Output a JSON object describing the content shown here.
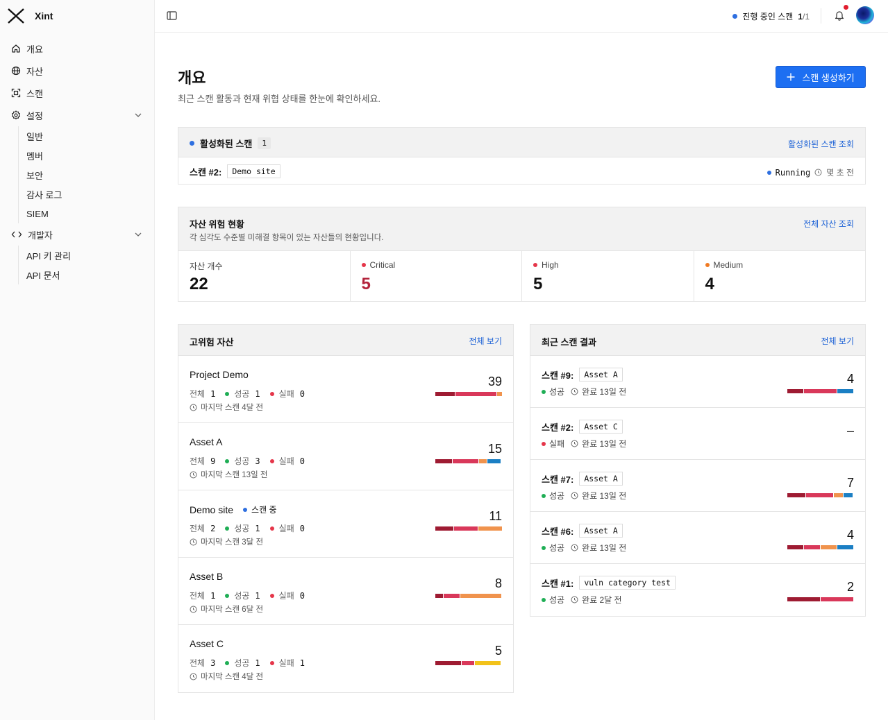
{
  "app": {
    "name": "Xint"
  },
  "colors": {
    "critical": "#9e1b32",
    "high": "#d9385a",
    "medium": "#f0934d",
    "low": "#f2c21a",
    "info": "#1b7fc4",
    "accent": "#1d6ff2"
  },
  "sidebar": {
    "items": [
      {
        "label": "개요",
        "icon": "home-icon"
      },
      {
        "label": "자산",
        "icon": "globe-icon"
      },
      {
        "label": "스캔",
        "icon": "scan-icon"
      },
      {
        "label": "설정",
        "icon": "gear-icon"
      },
      {
        "label": "개발자",
        "icon": "code-icon"
      }
    ],
    "settings_sub": [
      "일반",
      "멤버",
      "보안",
      "감사 로그",
      "SIEM"
    ],
    "developer_sub": [
      "API 키 관리",
      "API 문서"
    ]
  },
  "topbar": {
    "scan_status_label": "진행 중인 스캔",
    "scan_status_count": "1",
    "scan_status_total": "/1"
  },
  "page": {
    "title": "개요",
    "subtitle": "최근 스캔 활동과 현재 위협 상태를 한눈에 확인하세요.",
    "create_button": "스캔 생성하기"
  },
  "active_scans": {
    "title": "활성화된 스캔",
    "count": "1",
    "link": "활성화된 스캔 조회",
    "scan": {
      "label": "스캔 #2:",
      "asset": "Demo site",
      "status": "Running",
      "time": "몇 초 전"
    }
  },
  "asset_risk": {
    "title": "자산 위험 현황",
    "subtitle": "각 심각도 수준별 미해결 항목이 있는 자산들의 현황입니다.",
    "link": "전체 자산 조회",
    "stats": [
      {
        "label": "자산 개수",
        "value": "22"
      },
      {
        "label": "Critical",
        "value": "5"
      },
      {
        "label": "High",
        "value": "5"
      },
      {
        "label": "Medium",
        "value": "4"
      }
    ]
  },
  "high_risk_assets": {
    "title": "고위험 자산",
    "link": "전체 보기",
    "labels": {
      "total": "전체",
      "success": "성공",
      "fail": "실패",
      "scanning": "스캔 중"
    },
    "items": [
      {
        "name": "Project Demo",
        "total": "1",
        "success": "1",
        "fail": "0",
        "last_scan": "마지막 스캔 4달 전",
        "score": "39",
        "scanning": false,
        "segments": [
          {
            "sev": "critical",
            "frac": 0.3
          },
          {
            "sev": "high",
            "frac": 0.62
          },
          {
            "sev": "medium",
            "frac": 0.08
          }
        ]
      },
      {
        "name": "Asset A",
        "total": "9",
        "success": "3",
        "fail": "0",
        "last_scan": "마지막 스캔 13일 전",
        "score": "15",
        "scanning": false,
        "segments": [
          {
            "sev": "critical",
            "frac": 0.26
          },
          {
            "sev": "high",
            "frac": 0.4
          },
          {
            "sev": "medium",
            "frac": 0.13
          },
          {
            "sev": "info",
            "frac": 0.21
          }
        ]
      },
      {
        "name": "Demo site",
        "total": "2",
        "success": "1",
        "fail": "0",
        "last_scan": "마지막 스캔 3달 전",
        "score": "11",
        "scanning": true,
        "segments": [
          {
            "sev": "critical",
            "frac": 0.28
          },
          {
            "sev": "high",
            "frac": 0.36
          },
          {
            "sev": "medium",
            "frac": 0.36
          }
        ]
      },
      {
        "name": "Asset B",
        "total": "1",
        "success": "1",
        "fail": "0",
        "last_scan": "마지막 스캔 6달 전",
        "score": "8",
        "scanning": false,
        "segments": [
          {
            "sev": "critical",
            "frac": 0.12
          },
          {
            "sev": "high",
            "frac": 0.25
          },
          {
            "sev": "medium",
            "frac": 0.63
          }
        ]
      },
      {
        "name": "Asset C",
        "total": "3",
        "success": "1",
        "fail": "1",
        "last_scan": "마지막 스캔 4달 전",
        "score": "5",
        "scanning": false,
        "segments": [
          {
            "sev": "critical",
            "frac": 0.4
          },
          {
            "sev": "high",
            "frac": 0.2
          },
          {
            "sev": "low",
            "frac": 0.4
          }
        ]
      }
    ]
  },
  "recent_scans": {
    "title": "최근 스캔 결과",
    "link": "전체 보기",
    "items": [
      {
        "label": "스캔 #9:",
        "asset": "Asset A",
        "result": "성공",
        "status": "완료 13일 전",
        "score": "4",
        "ok": true,
        "segments": [
          {
            "sev": "critical",
            "frac": 0.25
          },
          {
            "sev": "high",
            "frac": 0.5
          },
          {
            "sev": "info",
            "frac": 0.25
          }
        ]
      },
      {
        "label": "스캔 #2:",
        "asset": "Asset C",
        "result": "실패",
        "status": "완료 13일 전",
        "score": "–",
        "ok": false,
        "segments": []
      },
      {
        "label": "스캔 #7:",
        "asset": "Asset A",
        "result": "성공",
        "status": "완료 13일 전",
        "score": "7",
        "ok": true,
        "segments": [
          {
            "sev": "critical",
            "frac": 0.28
          },
          {
            "sev": "high",
            "frac": 0.42
          },
          {
            "sev": "medium",
            "frac": 0.15
          },
          {
            "sev": "info",
            "frac": 0.15
          }
        ]
      },
      {
        "label": "스캔 #6:",
        "asset": "Asset A",
        "result": "성공",
        "status": "완료 13일 전",
        "score": "4",
        "ok": true,
        "segments": [
          {
            "sev": "critical",
            "frac": 0.25
          },
          {
            "sev": "high",
            "frac": 0.25
          },
          {
            "sev": "medium",
            "frac": 0.25
          },
          {
            "sev": "info",
            "frac": 0.25
          }
        ]
      },
      {
        "label": "스캔 #1:",
        "asset": "vuln category test",
        "result": "성공",
        "status": "완료 2달 전",
        "score": "2",
        "ok": true,
        "segments": [
          {
            "sev": "critical",
            "frac": 0.5
          },
          {
            "sev": "high",
            "frac": 0.5
          }
        ]
      }
    ]
  }
}
